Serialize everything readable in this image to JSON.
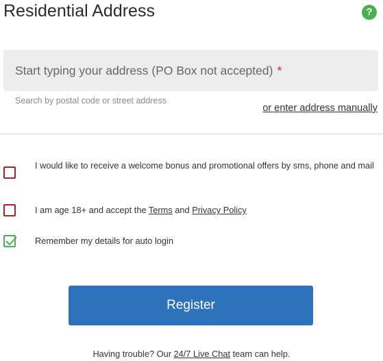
{
  "header": {
    "title": "Residential Address",
    "help_icon": "question-circle-icon",
    "help_symbol": "?"
  },
  "address": {
    "placeholder": "Start typing your address (PO Box not accepted)",
    "required_marker": "*",
    "hint": "Search by postal code or street address",
    "manual_link": "or enter address manually"
  },
  "consents": {
    "promo": {
      "checked": false,
      "label": "I would like to receive a welcome bonus and promotional offers by sms, phone and mail"
    },
    "age": {
      "checked": false,
      "label_prefix": "I am age 18+ and accept the ",
      "terms_link": "Terms",
      "label_mid": " and ",
      "privacy_link": "Privacy Policy"
    },
    "remember": {
      "checked": true,
      "label": "Remember my details for auto login"
    }
  },
  "register_label": "Register",
  "footer": {
    "prefix": "Having trouble? Our ",
    "link": "24/7 Live Chat",
    "suffix": " team can help."
  },
  "colors": {
    "accent": "#2f72bc",
    "success": "#4caf50",
    "error": "#b71c1c"
  }
}
